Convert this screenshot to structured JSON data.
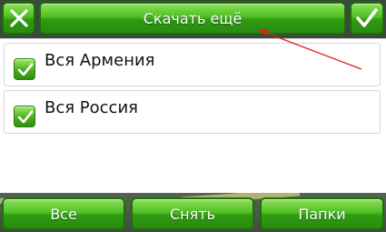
{
  "header": {
    "title_button": "Скачать ещё",
    "cancel_icon": "close-icon",
    "confirm_icon": "checkmark-icon"
  },
  "list": {
    "items": [
      {
        "label": "Вся Армения",
        "checked": true
      },
      {
        "label": "Вся Россия",
        "checked": true
      }
    ]
  },
  "footer": {
    "select_all_label": "Все",
    "deselect_label": "Снять",
    "folders_label": "Папки"
  },
  "colors": {
    "accent_green": "#3fae1c",
    "annotation_arrow": "#e0201c"
  }
}
